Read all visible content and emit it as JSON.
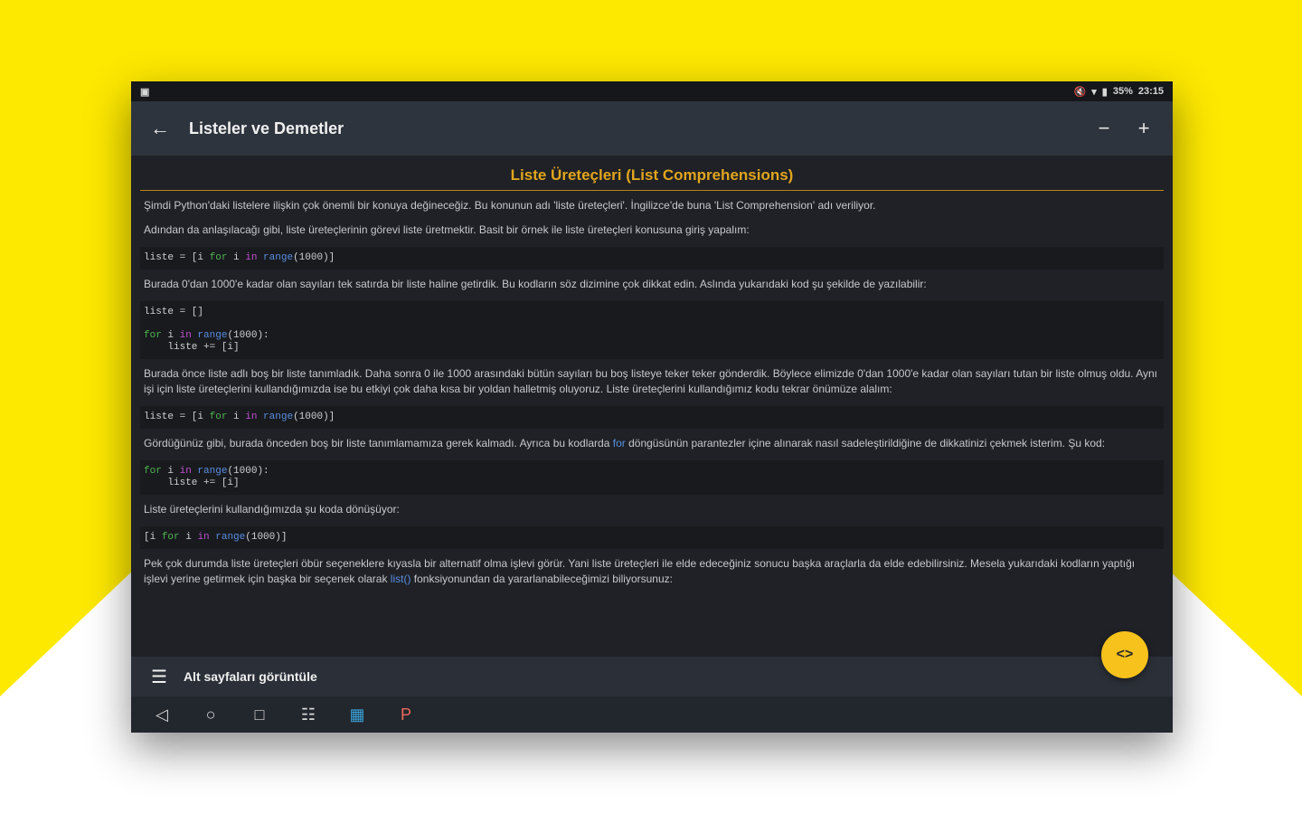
{
  "status_bar": {
    "battery": "35%",
    "time": "23:15"
  },
  "header": {
    "back_icon": "arrow-left-icon",
    "title": "Listeler ve Demetler",
    "zoom_out_icon": "minus-icon",
    "zoom_in_icon": "plus-icon"
  },
  "article": {
    "heading": "Liste Üreteçleri (List Comprehensions)",
    "p1": "Şimdi Python'daki listelere ilişkin çok önemli bir konuya değineceğiz. Bu konunun adı 'liste üreteçleri'. İngilizce'de buna 'List Comprehension' adı veriliyor.",
    "p2": "Adından da anlaşılacağı gibi, liste üreteçlerinin görevi liste üretmektir. Basit bir örnek ile liste üreteçleri konusuna giriş yapalım:",
    "code1": {
      "lhs": "liste = [i ",
      "kw": "for",
      "mid": " i ",
      "in": "in",
      "fn": " range",
      "rest": "(1000)]"
    },
    "p3": "Burada 0'dan 1000'e kadar olan sayıları tek satırda bir liste haline getirdik. Bu kodların söz dizimine çok dikkat edin. Aslında yukarıdaki kod şu şekilde de yazılabilir:",
    "code2": {
      "line1": "liste = []",
      "kw": "for",
      "mid": " i ",
      "in": "in",
      "fn": " range",
      "rest": "(1000):",
      "line3": "    liste += [i]"
    },
    "p4": "Burada önce liste adlı boş bir liste tanımladık. Daha sonra 0 ile 1000 arasındaki bütün sayıları bu boş listeye teker teker gönderdik. Böylece elimizde 0'dan 1000'e kadar olan sayıları tutan bir liste olmuş oldu. Aynı işi için liste üreteçlerini kullandığımızda ise bu etkiyi çok daha kısa bir yoldan halletmiş oluyoruz. Liste üreteçlerini kullandığımız kodu tekrar önümüze alalım:",
    "code3": {
      "lhs": "liste = [i ",
      "kw": "for",
      "mid": " i ",
      "in": "in",
      "fn": " range",
      "rest": "(1000)]"
    },
    "p5_before": "Gördüğünüz gibi, burada önceden boş bir liste tanımlamamıza gerek kalmadı. Ayrıca bu kodlarda ",
    "p5_link": "for",
    "p5_after": " döngüsünün parantezler içine alınarak nasıl sadeleştirildiğine de dikkatinizi çekmek isterim. Şu kod:",
    "code4": {
      "kw": "for",
      "mid": " i ",
      "in": "in",
      "fn": " range",
      "rest": "(1000):",
      "line2": "    liste += [i]"
    },
    "p6": "Liste üreteçlerini kullandığımızda şu koda dönüşüyor:",
    "code5": {
      "lhs": "[i ",
      "kw": "for",
      "mid": " i ",
      "in": "in",
      "fn": " range",
      "rest": "(1000)]"
    },
    "p7_before": "Pek çok durumda liste üreteçleri öbür seçeneklere kıyasla bir alternatif olma işlevi görür. Yani liste üreteçleri ile elde edeceğiniz sonucu başka araçlarla da elde edebilirsiniz. Mesela yukarıdaki kodların yaptığı işlevi yerine getirmek için başka bir seçenek olarak ",
    "p7_link": "list()",
    "p7_after": " fonksiyonundan da yararlanabileceğimizi biliyorsunuz:"
  },
  "bottom_sheet": {
    "label": "Alt sayfaları görüntüle"
  },
  "fab": {
    "label": "<>"
  }
}
